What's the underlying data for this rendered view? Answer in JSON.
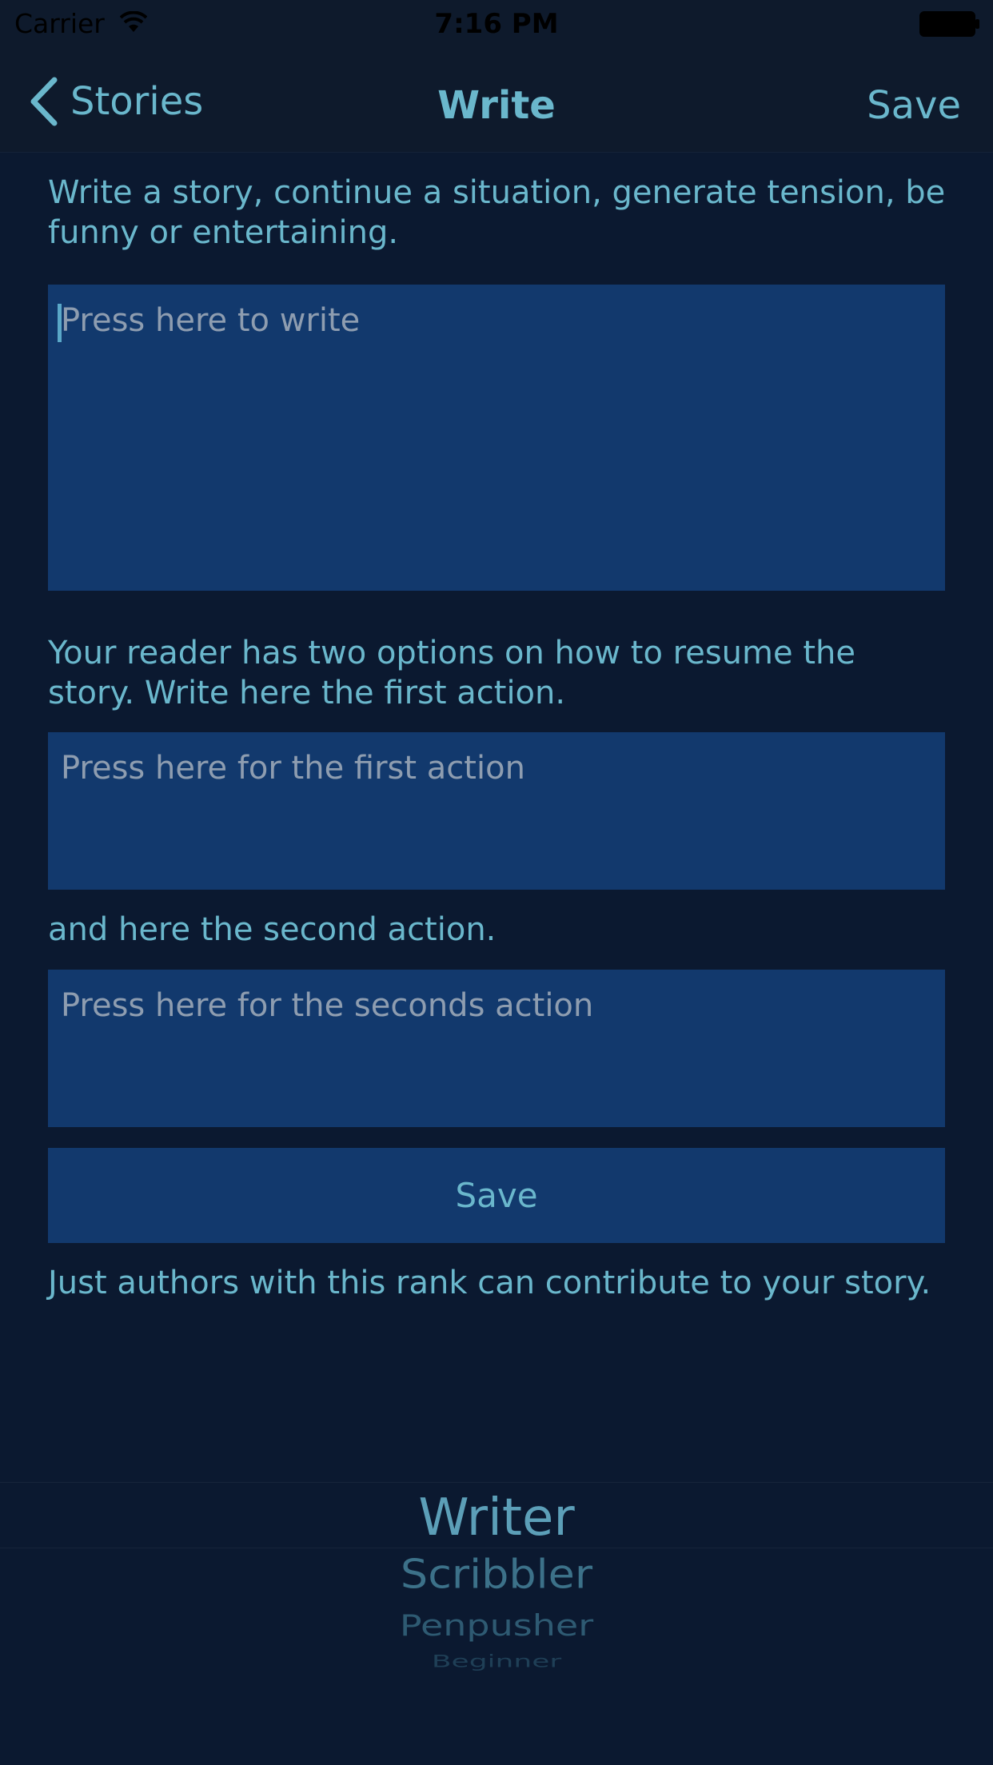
{
  "status_bar": {
    "carrier": "Carrier",
    "time": "7:16 PM"
  },
  "nav": {
    "back_label": "Stories",
    "title": "Write",
    "save_label": "Save"
  },
  "form": {
    "intro": "Write a story, continue a situation, generate tension, be funny or entertaining.",
    "story_placeholder": "Press here to write",
    "options_text": "Your reader has two options on how to resume the story. Write here the first action.",
    "first_action_placeholder": "Press here for the first action",
    "second_action_text": "and here the second action.",
    "second_action_placeholder": "Press here for the seconds action",
    "save_button": "Save",
    "rank_text": "Just authors with this rank can contribute to your story."
  },
  "rank_picker": {
    "selected": "Writer",
    "options": [
      "Writer",
      "Scribbler",
      "Penpusher",
      "Beginner"
    ]
  },
  "colors": {
    "background": "#0b1930",
    "accent": "#6ab7cc",
    "field": "#12396d"
  }
}
